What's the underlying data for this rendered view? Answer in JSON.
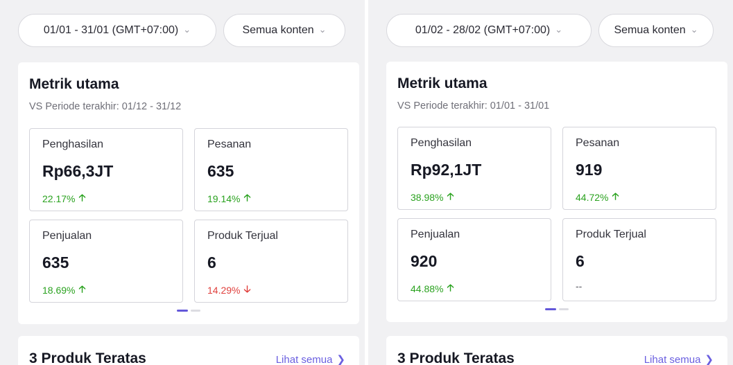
{
  "panels": [
    {
      "filters": {
        "date_range": "01/01 - 31/01 (GMT+07:00)",
        "content": "Semua konten"
      },
      "metrics": {
        "title": "Metrik utama",
        "subtitle": "VS Periode terakhir: 01/12 - 31/12",
        "tiles": [
          {
            "label": "Penghasilan",
            "value": "Rp66,3JT",
            "change": "22.17%",
            "trend": "up"
          },
          {
            "label": "Pesanan",
            "value": "635",
            "change": "19.14%",
            "trend": "up"
          },
          {
            "label": "Penjualan",
            "value": "635",
            "change": "18.69%",
            "trend": "up"
          },
          {
            "label": "Produk Terjual",
            "value": "6",
            "change": "14.29%",
            "trend": "down"
          }
        ]
      },
      "top_products": {
        "title": "3 Produk Teratas",
        "see_all": "Lihat semua"
      }
    },
    {
      "filters": {
        "date_range": "01/02 - 28/02 (GMT+07:00)",
        "content": "Semua konten"
      },
      "metrics": {
        "title": "Metrik utama",
        "subtitle": "VS Periode terakhir: 01/01 - 31/01",
        "tiles": [
          {
            "label": "Penghasilan",
            "value": "Rp92,1JT",
            "change": "38.98%",
            "trend": "up"
          },
          {
            "label": "Pesanan",
            "value": "919",
            "change": "44.72%",
            "trend": "up"
          },
          {
            "label": "Penjualan",
            "value": "920",
            "change": "44.88%",
            "trend": "up"
          },
          {
            "label": "Produk Terjual",
            "value": "6",
            "change": "--",
            "trend": "none"
          }
        ]
      },
      "top_products": {
        "title": "3 Produk Teratas",
        "see_all": "Lihat semua"
      }
    }
  ],
  "icons": {
    "chevron_down": "chevron-down-icon",
    "chevron_right": "chevron-right-icon",
    "arrow_up": "arrow-up-icon",
    "arrow_down": "arrow-down-icon"
  },
  "colors": {
    "positive": "#2aa21f",
    "negative": "#e0403d",
    "accent": "#6a5fe0",
    "background": "#f1f1f3"
  },
  "pagination": {
    "pages": 2,
    "active": 1
  }
}
